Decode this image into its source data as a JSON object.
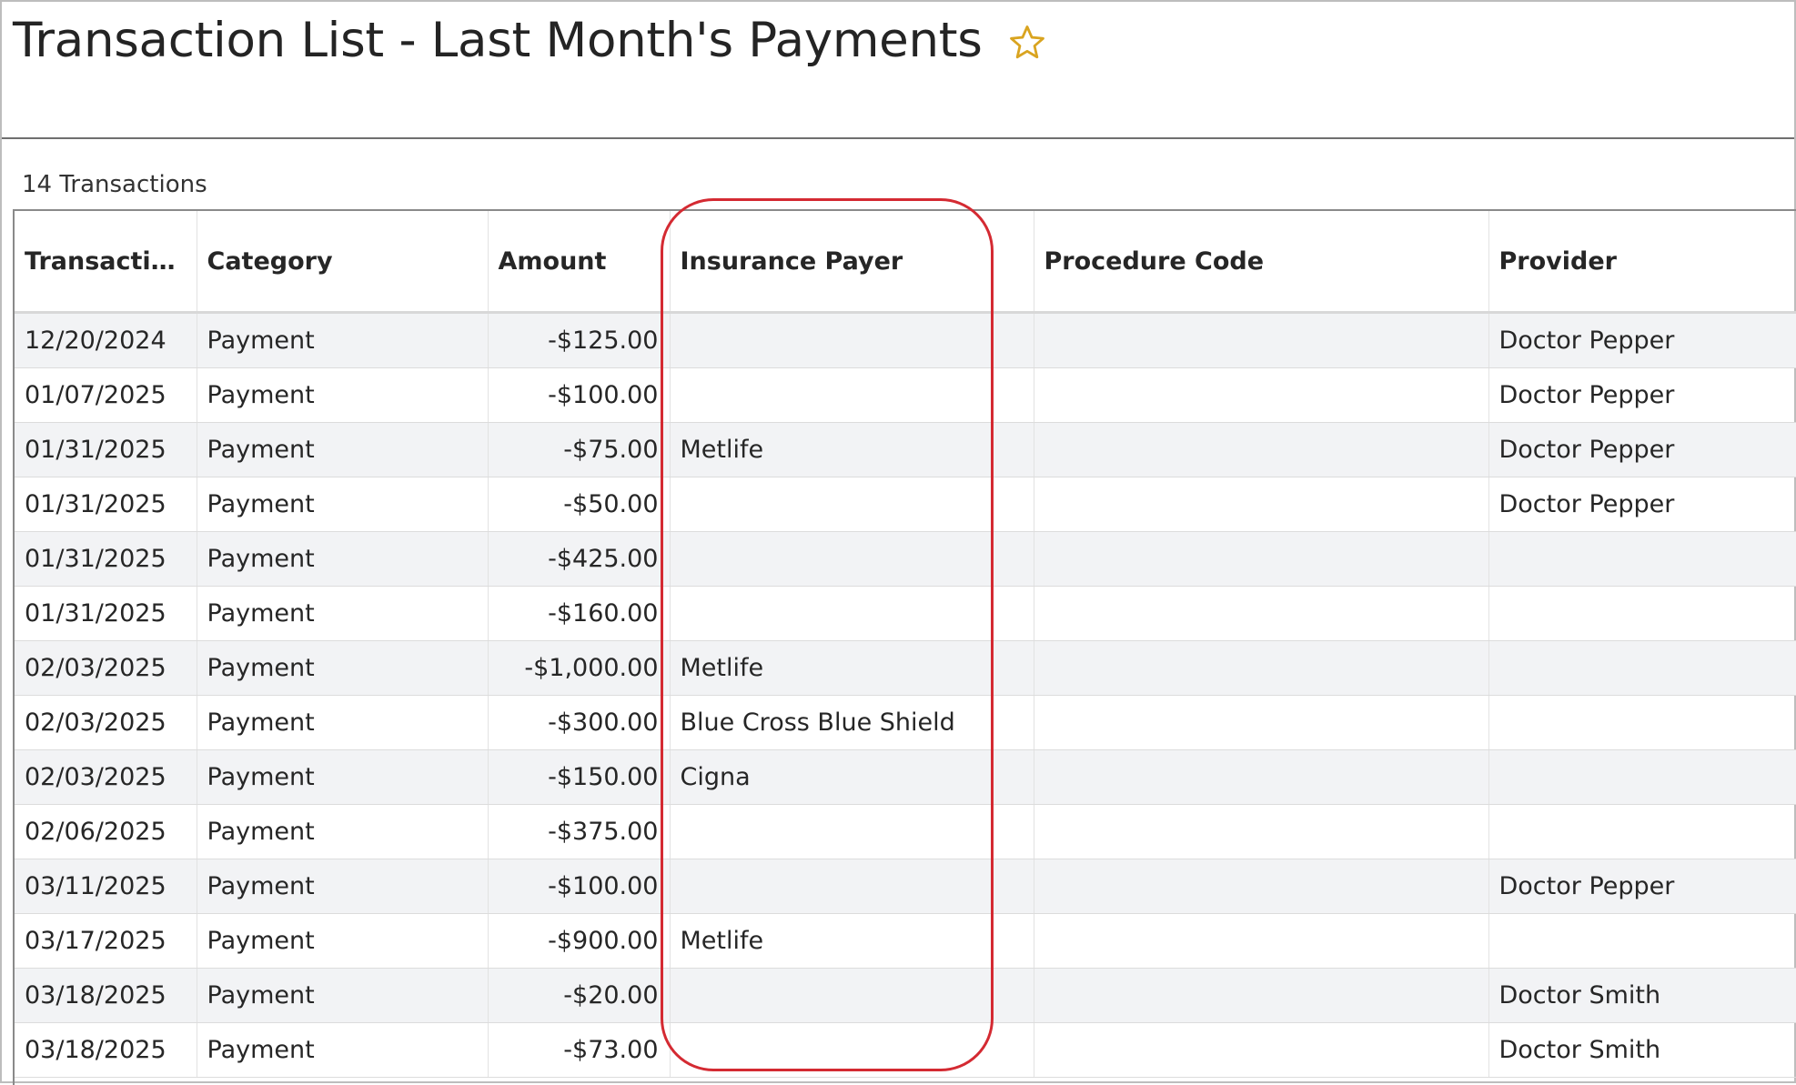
{
  "page": {
    "title": "Transaction List - Last Month's Payments",
    "favorite_icon": "star-icon",
    "star_color": "#d9a420"
  },
  "summary": {
    "count_label": "14 Transactions"
  },
  "table": {
    "columns": [
      "Transactio...",
      "Category",
      "Amount",
      "Insurance Payer",
      "Procedure Code",
      "Provider"
    ],
    "rows": [
      [
        "12/20/2024",
        "Payment",
        "-$125.00",
        "",
        "",
        "Doctor Pepper"
      ],
      [
        "01/07/2025",
        "Payment",
        "-$100.00",
        "",
        "",
        "Doctor Pepper"
      ],
      [
        "01/31/2025",
        "Payment",
        "-$75.00",
        "Metlife",
        "",
        "Doctor Pepper"
      ],
      [
        "01/31/2025",
        "Payment",
        "-$50.00",
        "",
        "",
        "Doctor Pepper"
      ],
      [
        "01/31/2025",
        "Payment",
        "-$425.00",
        "",
        "",
        ""
      ],
      [
        "01/31/2025",
        "Payment",
        "-$160.00",
        "",
        "",
        ""
      ],
      [
        "02/03/2025",
        "Payment",
        "-$1,000.00",
        "Metlife",
        "",
        ""
      ],
      [
        "02/03/2025",
        "Payment",
        "-$300.00",
        "Blue Cross Blue Shield",
        "",
        ""
      ],
      [
        "02/03/2025",
        "Payment",
        "-$150.00",
        "Cigna",
        "",
        ""
      ],
      [
        "02/06/2025",
        "Payment",
        "-$375.00",
        "",
        "",
        ""
      ],
      [
        "03/11/2025",
        "Payment",
        "-$100.00",
        "",
        "",
        "Doctor Pepper"
      ],
      [
        "03/17/2025",
        "Payment",
        "-$900.00",
        "Metlife",
        "",
        ""
      ],
      [
        "03/18/2025",
        "Payment",
        "-$20.00",
        "",
        "",
        "Doctor Smith"
      ],
      [
        "03/18/2025",
        "Payment",
        "-$73.00",
        "",
        "",
        "Doctor Smith"
      ]
    ]
  },
  "annotation": {
    "highlight_color": "#d42a32"
  }
}
